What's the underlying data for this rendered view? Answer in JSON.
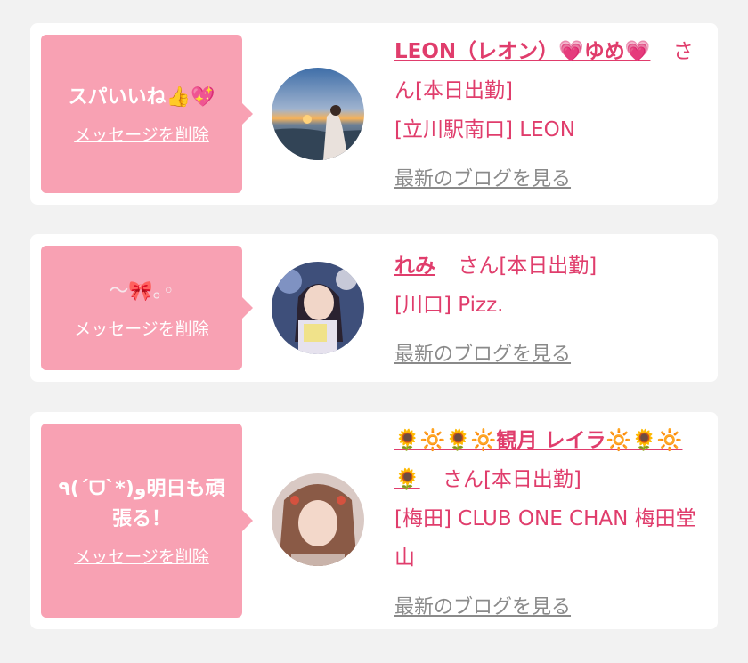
{
  "cards": [
    {
      "message": "スパいいね👍💖",
      "delete_label": "メッセージを削除",
      "name": "LEON（レオン）💗ゆめ💗",
      "san_label": "さん",
      "status": "[本日出勤]",
      "location": "[立川駅南口] LEON",
      "blog_label": "最新のブログを見る",
      "avatar_icon": "sunset-beach-photo"
    },
    {
      "message": "～🎀｡◦",
      "delete_label": "メッセージを削除",
      "name": "れみ",
      "san_label": "さん",
      "status": "[本日出勤]",
      "location": "[川口] Pizz.",
      "blog_label": "最新のブログを見る",
      "avatar_icon": "girl-selfie-photo"
    },
    {
      "message": "٩(ˊᗜˋ*)و明日も頑張る！",
      "delete_label": "メッセージを削除",
      "name": "🌻🔆🌻🔆観月 レイラ🔆🌻🔆🌻",
      "san_label": "さん",
      "status": "[本日出勤]",
      "location": "[梅田] CLUB ONE CHAN 梅田堂山",
      "blog_label": "最新のブログを見る",
      "avatar_icon": "girl-portrait-photo"
    }
  ],
  "colors": {
    "bubble": "#f8a1b3",
    "accent": "#e03d6c",
    "link_gray": "#8a8a8a",
    "background": "#f2f2f2"
  }
}
